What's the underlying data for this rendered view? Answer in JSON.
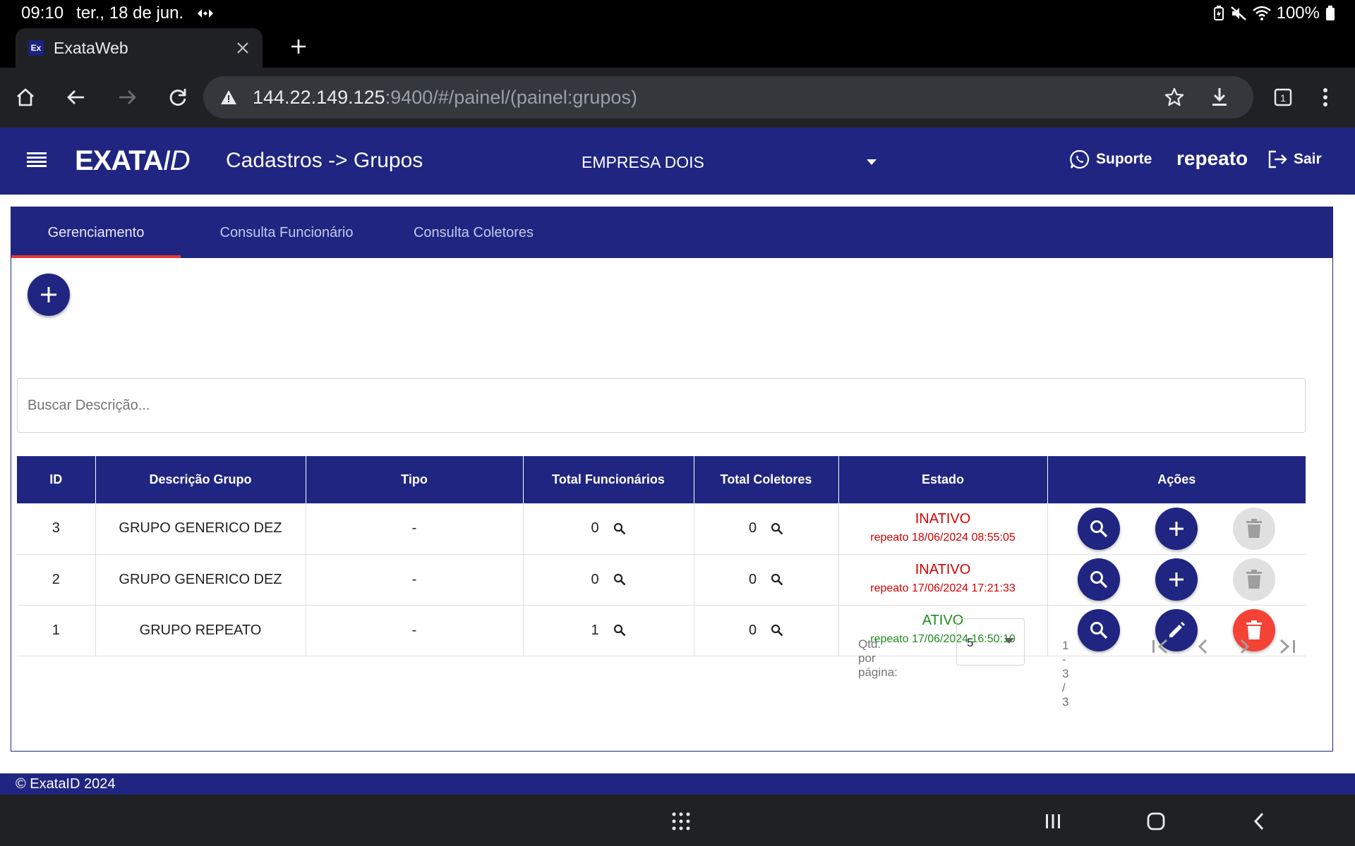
{
  "status_bar": {
    "time": "09:10",
    "date": "ter., 18 de jun.",
    "battery": "100%"
  },
  "browser": {
    "tab_title": "ExataWeb",
    "tab_favicon": "Ex",
    "url_host": "144.22.149.125",
    "url_rest": ":9400/#/painel/(painel:grupos)",
    "tab_count": "1"
  },
  "header": {
    "logo_main": "EXATA",
    "logo_suffix": "ID",
    "title": "Cadastros -> Grupos",
    "company": "EMPRESA DOIS",
    "support_label": "Suporte",
    "username": "repeato",
    "logout_label": "Sair"
  },
  "tabs": [
    {
      "label": "Gerenciamento",
      "active": true
    },
    {
      "label": "Consulta Funcionário",
      "active": false
    },
    {
      "label": "Consulta Coletores",
      "active": false
    }
  ],
  "search": {
    "placeholder": "Buscar Descrição..."
  },
  "table": {
    "columns": [
      "ID",
      "Descrição Grupo",
      "Tipo",
      "Total Funcionários",
      "Total Coletores",
      "Estado",
      "Ações"
    ],
    "rows": [
      {
        "id": "3",
        "descricao": "GRUPO GENERICO DEZ",
        "tipo": "-",
        "total_funcionarios": "0",
        "total_coletores": "0",
        "estado": "INATIVO",
        "estado_info": "repeato 18/06/2024 08:55:05"
      },
      {
        "id": "2",
        "descricao": "GRUPO GENERICO DEZ",
        "tipo": "-",
        "total_funcionarios": "0",
        "total_coletores": "0",
        "estado": "INATIVO",
        "estado_info": "repeato 17/06/2024 17:21:33"
      },
      {
        "id": "1",
        "descricao": "GRUPO REPEATO",
        "tipo": "-",
        "total_funcionarios": "1",
        "total_coletores": "0",
        "estado": "ATIVO",
        "estado_info": "repeato 17/06/2024 16:50:10"
      }
    ]
  },
  "pagination": {
    "label": "Qtd. por página:",
    "page_size": "5",
    "range": "1 - 3 / 3"
  },
  "footer": {
    "copyright": "© ExataID 2024"
  },
  "colors": {
    "primary": "#1f2581",
    "inactive": "#d50000",
    "active": "#1e8c1e",
    "danger": "#f44336",
    "tab_indicator": "#e53935"
  }
}
